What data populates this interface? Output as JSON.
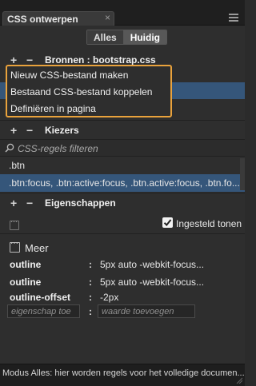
{
  "window": {
    "tab_title": "CSS ontwerpen",
    "tab_close": "×"
  },
  "mode_toggle": {
    "all_label": "Alles",
    "current_label": "Huidig",
    "selected": "Huidig"
  },
  "sources": {
    "header_label": "Bronnen : bootstrap.css",
    "menu_items": [
      "Nieuw CSS-bestand maken",
      "Bestaand CSS-bestand koppelen",
      "Definiëren in pagina"
    ]
  },
  "selectors": {
    "header_label": "Kiezers",
    "search_placeholder": "CSS-regels filteren",
    "items": [
      ".btn",
      ".btn:focus, .btn:active:focus, .btn.active:focus, .btn.fo..."
    ],
    "selected_index": 1
  },
  "properties": {
    "header_label": "Eigenschappen",
    "show_set_label": "Ingesteld tonen",
    "show_set_checked": true,
    "more_label": "Meer",
    "rows": [
      {
        "name": "outline",
        "value": "5px auto -webkit-focus..."
      },
      {
        "name": "outline",
        "value": "5px auto -webkit-focus..."
      },
      {
        "name": "outline-offset",
        "value": "-2px"
      }
    ],
    "colon": ":",
    "add_property_placeholder": "eigenschap toe",
    "add_value_placeholder": "waarde toevoegen"
  },
  "status": {
    "text": "Modus Alles: hier worden regels voor het volledige documen..."
  },
  "colors": {
    "accent_outline": "#e9a23c",
    "selection": "#35567a",
    "panel_bg": "#2e2e2e"
  }
}
